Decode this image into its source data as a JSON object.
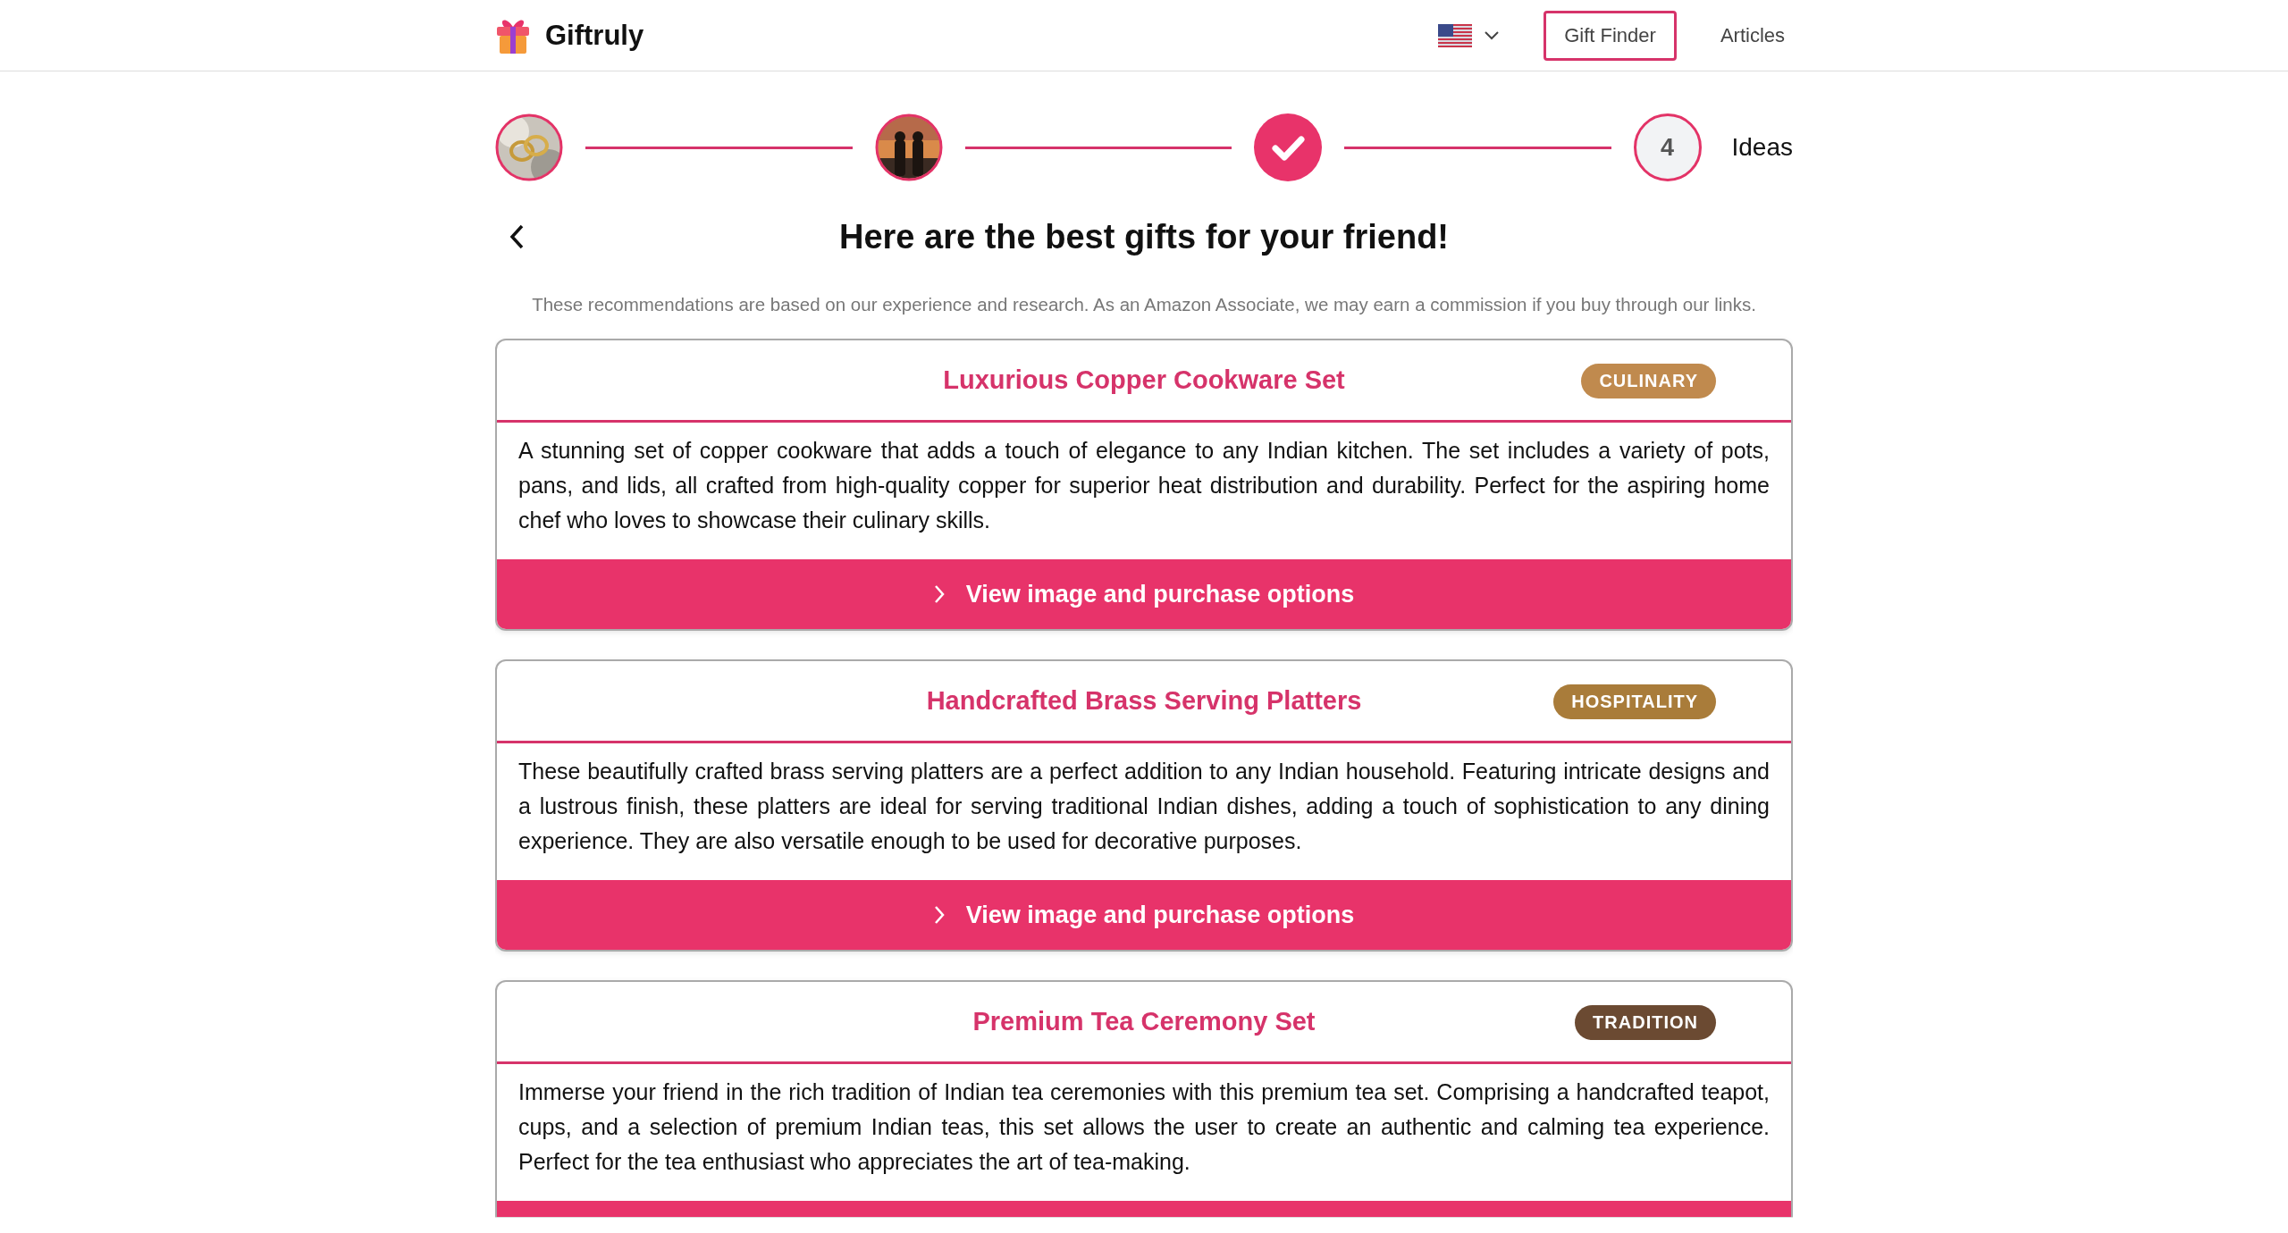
{
  "header": {
    "brand": "Giftruly",
    "nav": [
      {
        "label": "Gift Finder",
        "selected": true
      },
      {
        "label": "Articles",
        "selected": false
      }
    ]
  },
  "steps": [
    {
      "kind": "picture"
    },
    {
      "kind": "picture"
    },
    {
      "kind": "done"
    },
    {
      "kind": "number",
      "number": "4",
      "label": "Ideas"
    }
  ],
  "title": "Here are the best gifts for your friend!",
  "disclaimer": "These recommendations are based on our experience and research. As an Amazon Associate, we may earn a commission if you buy through our links.",
  "gifts": [
    {
      "title": "Luxurious Copper Cookware Set",
      "tag": "CULINARY",
      "color": "#c08a4e",
      "description": "A stunning set of copper cookware that adds a touch of elegance to any Indian kitchen. The set includes a variety of pots, pans, and lids, all crafted from high-quality copper for superior heat distribution and durability. Perfect for the aspiring home chef who loves to showcase their culinary skills.",
      "button": "View image and purchase options"
    },
    {
      "title": "Handcrafted Brass Serving Platters",
      "tag": "HOSPITALITY",
      "color": "#a97c3a",
      "description": "These beautifully crafted brass serving platters are a perfect addition to any Indian household. Featuring intricate designs and a lustrous finish, these platters are ideal for serving traditional Indian dishes, adding a touch of sophistication to any dining experience. They are also versatile enough to be used for decorative purposes.",
      "button": "View image and purchase options"
    },
    {
      "title": "Premium Tea Ceremony Set",
      "tag": "TRADITION",
      "color": "#6b4a32",
      "description": "Immerse your friend in the rich tradition of Indian tea ceremonies with this premium tea set. Comprising a handcrafted teapot, cups, and a selection of premium Indian teas, this set allows the user to create an authentic and calming tea experience. Perfect for the tea enthusiast who appreciates the art of tea-making."
    }
  ]
}
